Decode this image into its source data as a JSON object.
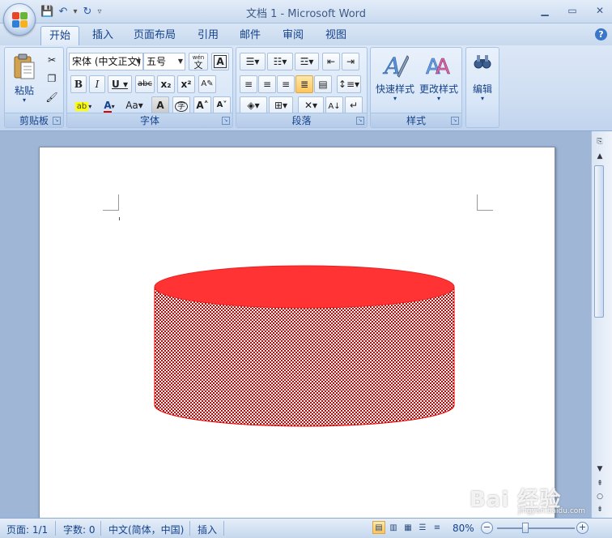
{
  "window": {
    "title": "文档 1 - Microsoft Word"
  },
  "tabs": [
    {
      "label": "开始",
      "active": true
    },
    {
      "label": "插入"
    },
    {
      "label": "页面布局"
    },
    {
      "label": "引用"
    },
    {
      "label": "邮件"
    },
    {
      "label": "审阅"
    },
    {
      "label": "视图"
    }
  ],
  "ribbon": {
    "clipboard": {
      "label": "剪贴板",
      "paste": "粘贴"
    },
    "font": {
      "label": "字体",
      "name": "宋体 (中文正文)",
      "size": "五号",
      "phonetic": "wén"
    },
    "paragraph": {
      "label": "段落"
    },
    "styles": {
      "label": "样式",
      "quick": "快速样式",
      "change": "更改样式"
    },
    "editing": {
      "label": "编辑"
    }
  },
  "status": {
    "page": "页面: 1/1",
    "words": "字数: 0",
    "language": "中文(简体，中国)",
    "mode": "插入",
    "zoom": "80%"
  },
  "shape": {
    "type": "cylinder",
    "top_color": "#ff3333",
    "side_color": "#d40000"
  },
  "watermark": {
    "text": "Bai 经验",
    "sub": "jingyan.baidu.com"
  },
  "colors": {
    "highlight": "#ffff00",
    "font_color": "#e00000"
  }
}
